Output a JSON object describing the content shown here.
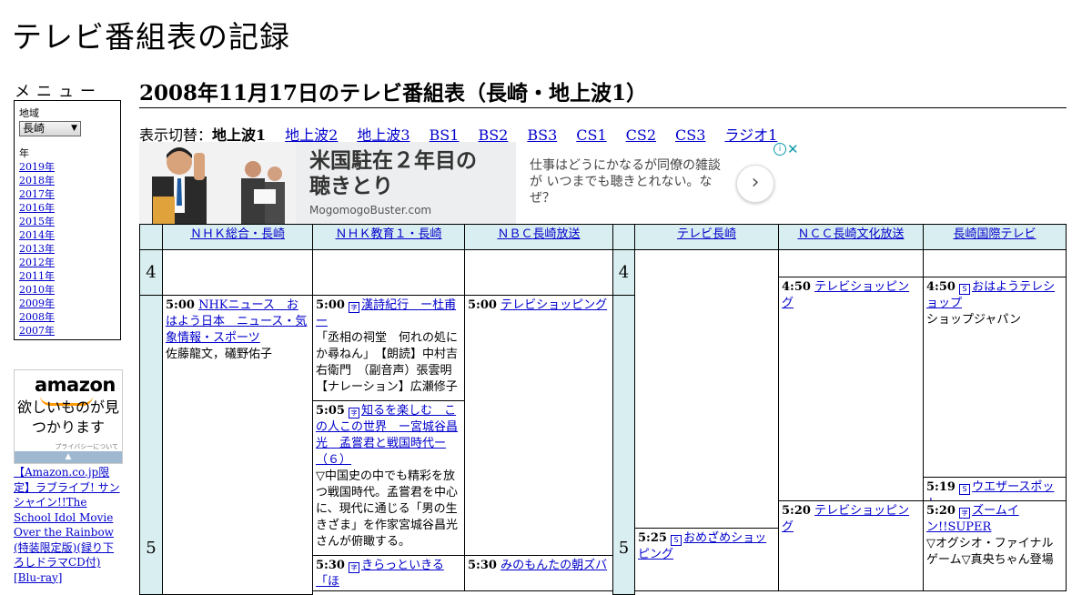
{
  "site_title": "テレビ番組表の記録",
  "menu": {
    "heading": "メニュー",
    "region_label": "地域",
    "region_value": "長崎",
    "year_label": "年",
    "years": [
      "2019年",
      "2018年",
      "2017年",
      "2016年",
      "2015年",
      "2014年",
      "2013年",
      "2012年",
      "2011年",
      "2010年",
      "2009年",
      "2008年",
      "2007年"
    ]
  },
  "amazon": {
    "logo": "amazon",
    "tagline": "欲しいものが見つかります",
    "privacy": "プライバシーについて",
    "product_link": "【Amazon.co.jp限定】ラブライブ! サンシャイン!!The School Idol Movie Over the Rainbow (特装限定版)(録り下ろしドラマCD付) [Blu-ray]"
  },
  "page_heading": "2008年11月17日のテレビ番組表（長崎・地上波1）",
  "switcher": {
    "label": "表示切替：",
    "current": "地上波1",
    "links": [
      "地上波2",
      "地上波3",
      "BS1",
      "BS2",
      "BS3",
      "CS1",
      "CS2",
      "CS3",
      "ラジオ1"
    ]
  },
  "ad": {
    "headline": "米国駐在２年目の聴きとり",
    "domain": "MogomogoBuster.com",
    "description": "仕事はどうにかなるが同僚の雑談が いつまでも聴きとれない。なぜ？",
    "next_symbol": "›",
    "info_symbol": "i",
    "close_symbol": "✕"
  },
  "channels": [
    "ＮＨＫ総合・長崎",
    "ＮＨＫ教育１・長崎",
    "ＮＢＣ長崎放送",
    "テレビ長崎",
    "ＮＣＣ長崎文化放送",
    "長崎国際テレビ"
  ],
  "hours": [
    "4",
    "5"
  ],
  "programs": {
    "nhk_g_500": {
      "time": "5:00",
      "title": "NHKニュース　おはよう日本　ニュース・気象情報・スポーツ",
      "desc": "佐藤龍文，礒野佑子"
    },
    "nhk_e_500": {
      "time": "5:00",
      "badge": "字",
      "title": "漢詩紀行　ー杜甫ー",
      "desc": "「丞相の祠堂　何れの処にか尋ねん」　【朗読】中村吉右衛門　（副音声）張雲明【ナレーション】広瀬修子"
    },
    "nhk_e_505": {
      "time": "5:05",
      "badge": "字",
      "title": "知るを楽しむ　この人この世界　ー宮城谷昌光　孟嘗君と戦国時代ー（６）",
      "desc": "▽中国史の中でも精彩を放つ戦国時代。孟嘗君を中心に、現代に通じる「男の生きざま」を作家宮城谷昌光さんが俯瞰する。"
    },
    "nhk_e_530": {
      "time": "5:30",
      "badge": "字",
      "title": "きらっといきる「ほ"
    },
    "nbc_500": {
      "time": "5:00",
      "title": "テレビショッピング"
    },
    "nbc_530": {
      "time": "5:30",
      "title": "みのもんたの朝ズバ"
    },
    "ktn_525": {
      "time": "5:25",
      "badge": "S",
      "title": "おめざめショッピング"
    },
    "ncc_450": {
      "time": "4:50",
      "title": "テレビショッピング"
    },
    "ncc_520": {
      "time": "5:20",
      "title": "テレビショッピング"
    },
    "nib_450": {
      "time": "4:50",
      "badge": "S",
      "title": "おはようテレショップ",
      "desc": "ショップジャパン"
    },
    "nib_519": {
      "time": "5:19",
      "badge": "S",
      "title": "ウエザースポット"
    },
    "nib_520": {
      "time": "5:20",
      "badge": "字",
      "title": "ズームイン!!SUPER",
      "desc": "▽オグシオ・ファイナルゲーム▽真央ちゃん登場"
    }
  }
}
